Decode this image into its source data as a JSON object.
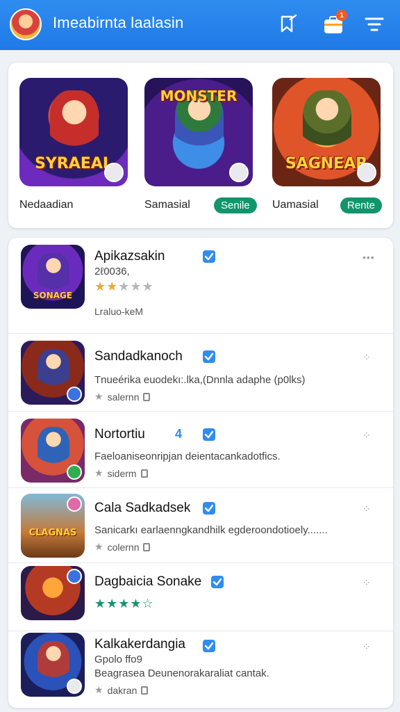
{
  "header": {
    "title": "Imeabirnta laalasin",
    "notification_count": "1",
    "icons": [
      "avatar",
      "bookmark-icon",
      "briefcase-icon",
      "filter-icon"
    ]
  },
  "featured": [
    {
      "name": "Nedaadian",
      "thumb_text": "SYRAEAL",
      "pill": ""
    },
    {
      "name": "Samasial",
      "thumb_text": "MONSTER",
      "pill": "Senile"
    },
    {
      "name": "Uamasial",
      "thumb_text": "SAGNEAR",
      "pill": "Rente"
    }
  ],
  "apps": [
    {
      "name": "Apikazsakin",
      "sub": "2ℓ0036,",
      "rating": 2,
      "rating_max": 5,
      "rating_color": "orange",
      "meta": "Lraluo-keM",
      "thumb_text": "SONAGE",
      "count": ""
    },
    {
      "name": "Sandadkanoch",
      "sub": "Tnueérika euodekı:.lka,(Dnnla adaphe (p0lks)",
      "meta": "salernn",
      "count": ""
    },
    {
      "name": "Nortortiu",
      "sub": "Faeloaniseonripjan deientacankadotfics.",
      "meta": "siderm",
      "count": "4"
    },
    {
      "name": "Cala Sadkadsek",
      "sub": "Sanicarkı earlaenngkandhilk egderoondotioely.......",
      "meta": "colernn",
      "thumb_text": "CLAGNAS",
      "count": ""
    },
    {
      "name": "Dagbaicia Sonake",
      "rating": 4.5,
      "rating_max": 5,
      "rating_color": "green",
      "thumb_text": "",
      "count": ""
    },
    {
      "name": "Kalkakerdangia",
      "sub": "Gpolo ffo9",
      "sub2": "Beagrasea Deunenorakaraliat cantak.",
      "meta": "dakran",
      "count": ""
    }
  ],
  "colors": {
    "appbar": "#2f8cf0",
    "accent_green": "#13956c",
    "verified_blue": "#2f8cf0",
    "star_orange": "#f2a531"
  }
}
